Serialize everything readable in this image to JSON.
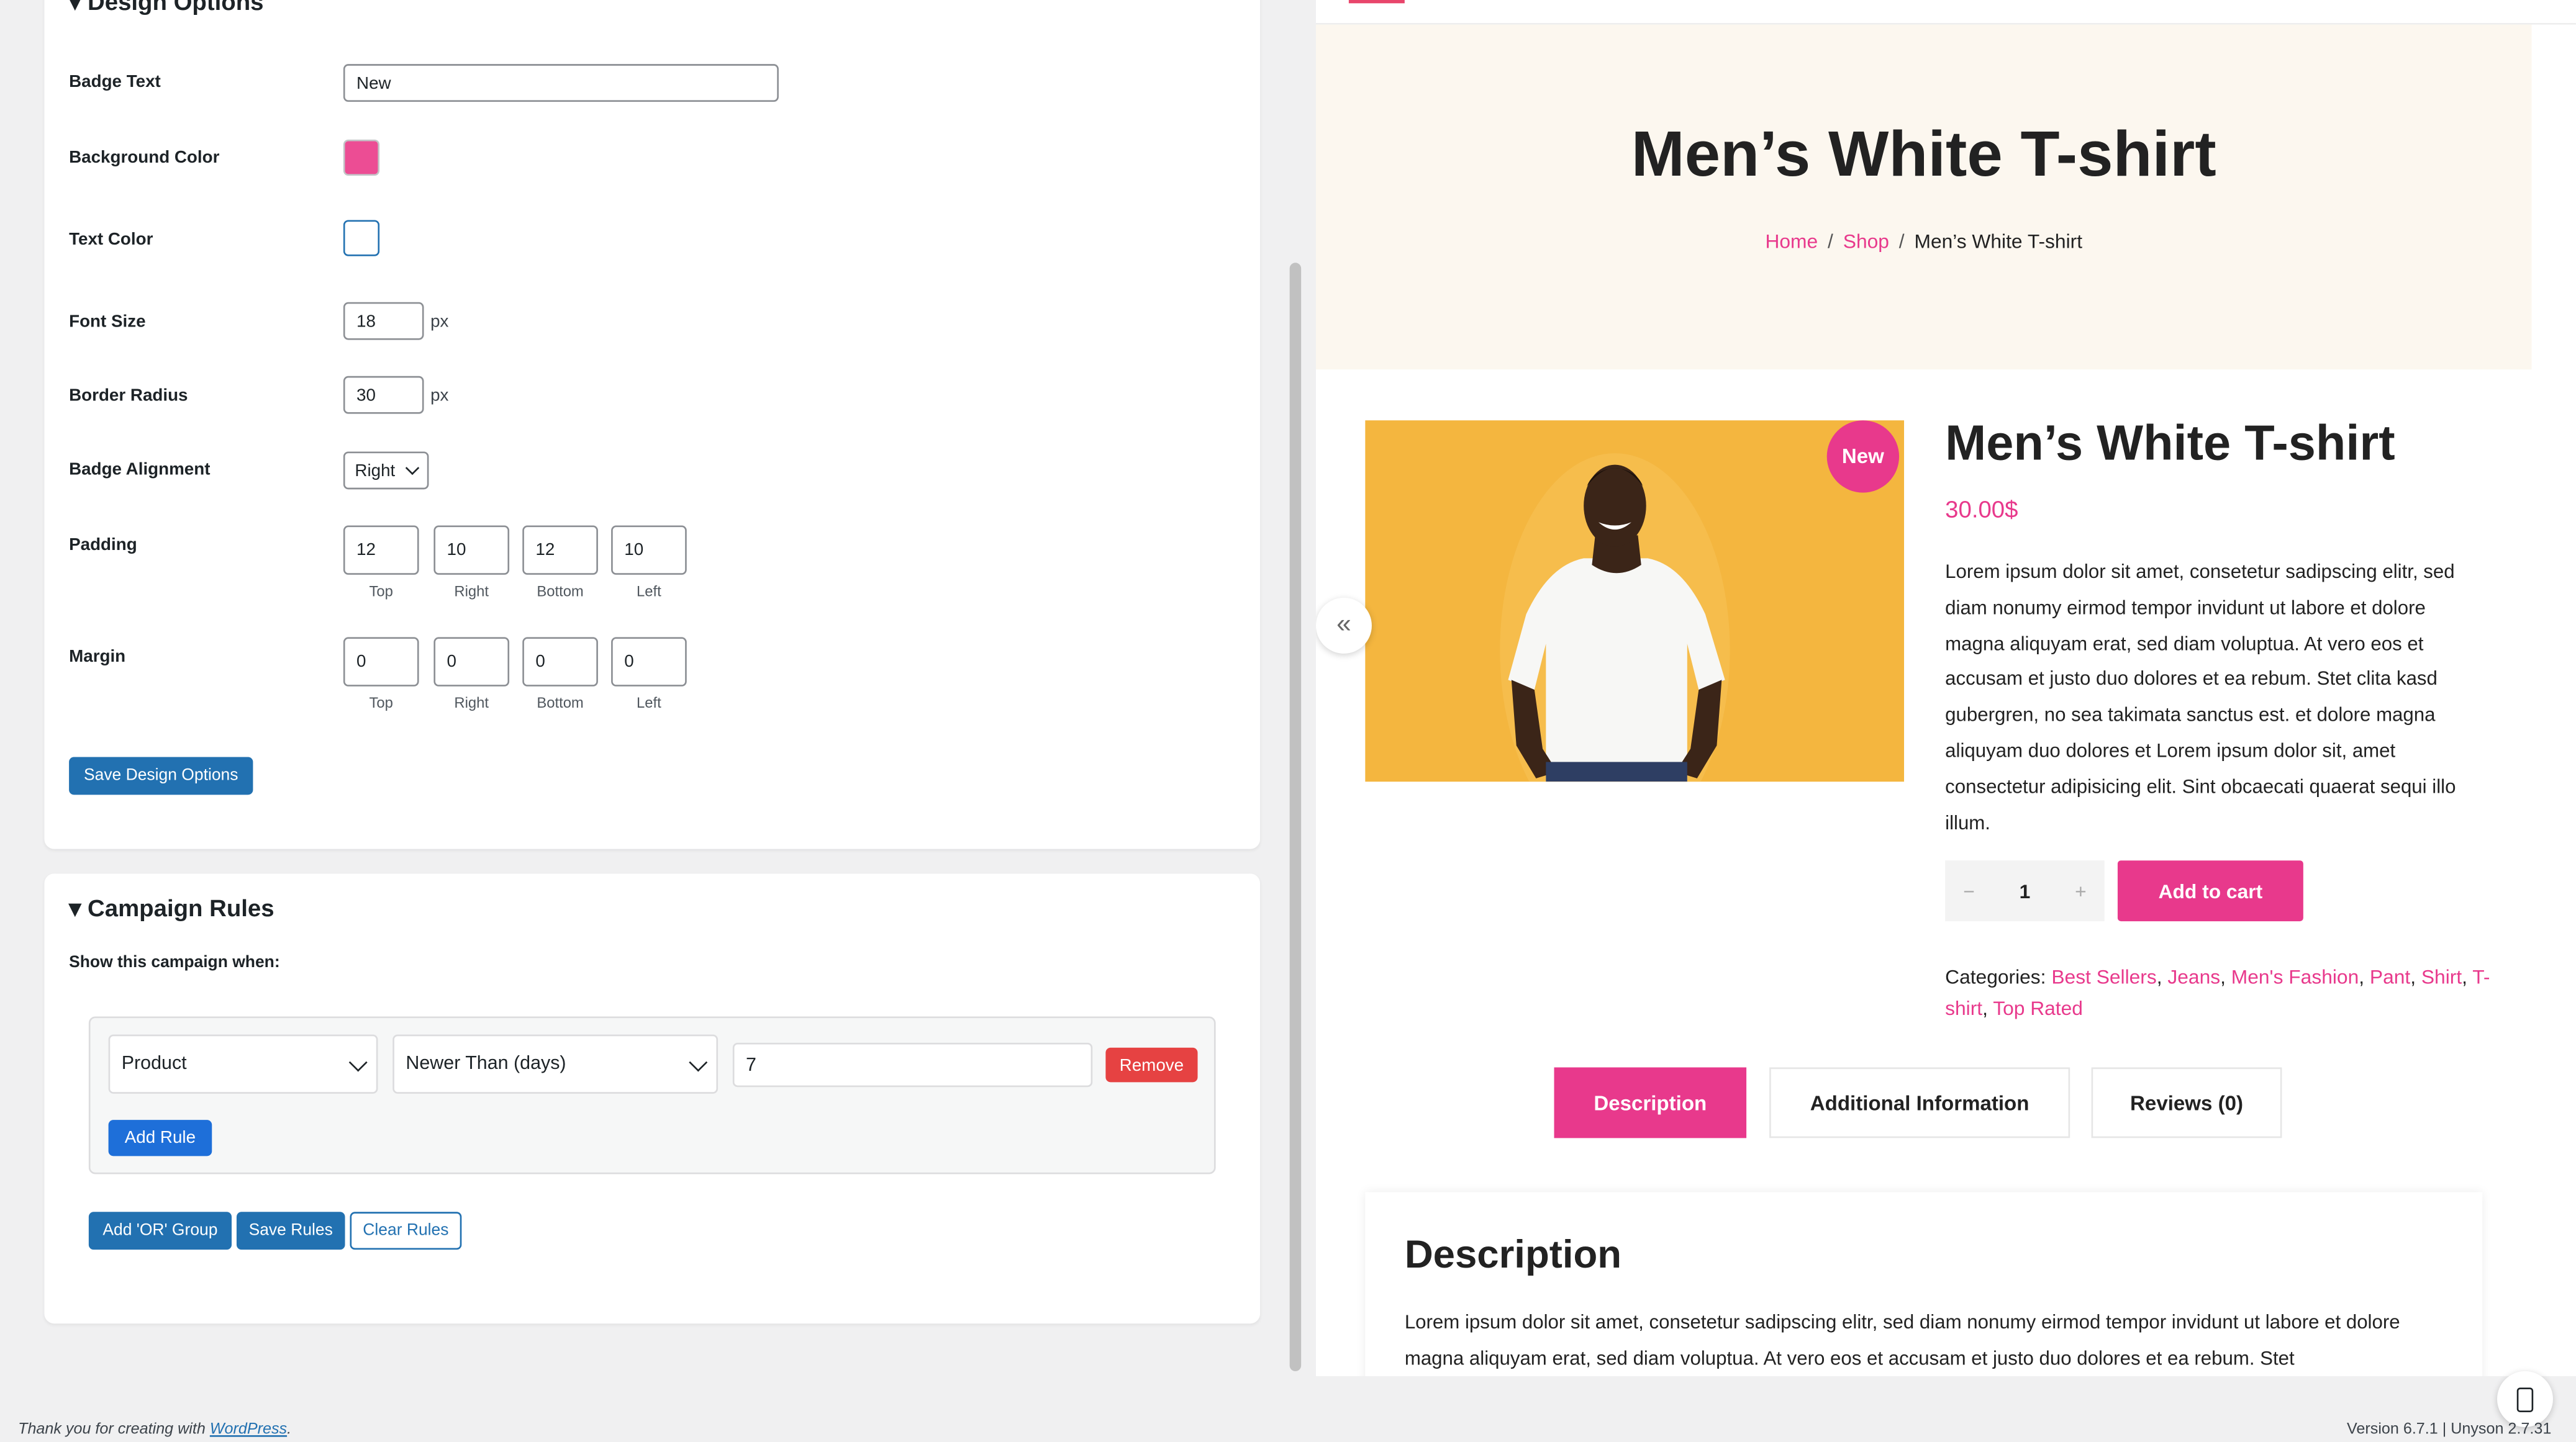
{
  "design": {
    "title": "Design Options",
    "badge_text_label": "Badge Text",
    "badge_text_value": "New",
    "bg_color_label": "Background Color",
    "bg_color": "#ec4d94",
    "text_color_label": "Text Color",
    "text_color": "#ffffff",
    "font_size_label": "Font Size",
    "font_size_value": "18",
    "border_radius_label": "Border Radius",
    "border_radius_value": "30",
    "unit_px": "px",
    "alignment_label": "Badge Alignment",
    "alignment_value": "Right",
    "padding_label": "Padding",
    "padding": [
      {
        "value": "12",
        "side": "Top"
      },
      {
        "value": "10",
        "side": "Right"
      },
      {
        "value": "12",
        "side": "Bottom"
      },
      {
        "value": "10",
        "side": "Left"
      }
    ],
    "margin_label": "Margin",
    "margin": [
      {
        "value": "0",
        "side": "Top"
      },
      {
        "value": "0",
        "side": "Right"
      },
      {
        "value": "0",
        "side": "Bottom"
      },
      {
        "value": "0",
        "side": "Left"
      }
    ],
    "save_label": "Save Design Options"
  },
  "rules": {
    "title": "Campaign Rules",
    "intro": "Show this campaign when:",
    "rule": {
      "subject": "Product",
      "condition": "Newer Than (days)",
      "value": "7",
      "remove_label": "Remove"
    },
    "add_rule_label": "Add Rule",
    "add_or_label": "Add 'OR' Group",
    "save_label": "Save Rules",
    "clear_label": "Clear Rules"
  },
  "preview": {
    "hero_title": "Men’s White T-shirt",
    "breadcrumb": {
      "home": "Home",
      "shop": "Shop",
      "current": "Men’s White T-shirt",
      "sep": "/"
    },
    "badge": "New",
    "gallery_arrow": "«",
    "product_title": "Men’s White T-shirt",
    "price": "30.00$",
    "description": "Lorem ipsum dolor sit amet, consetetur sadipscing elitr, sed diam nonumy eirmod tempor invidunt ut labore et dolore magna aliquyam erat, sed diam voluptua. At vero eos et accusam et justo duo dolores et ea rebum. Stet clita kasd gubergren, no sea takimata sanctus est. et dolore magna aliquyam duo dolores et Lorem ipsum dolor sit, amet consectetur adipisicing elit. Sint obcaecati quaerat sequi illo illum.",
    "qty": {
      "minus": "−",
      "value": "1",
      "plus": "+"
    },
    "add_to_cart": "Add to cart",
    "categories_label": "Categories:",
    "categories": [
      "Best Sellers",
      "Jeans",
      "Men's Fashion",
      "Pant",
      "Shirt",
      "T-shirt",
      "Top Rated"
    ],
    "tabs": [
      "Description",
      "Additional Information",
      "Reviews (0)"
    ],
    "desc_heading": "Description",
    "desc_body": "Lorem ipsum dolor sit amet, consetetur sadipscing elitr, sed diam nonumy eirmod tempor invidunt ut labore et dolore magna aliquyam erat, sed diam voluptua. At vero eos et accusam et justo duo dolores et ea rebum. Stet"
  },
  "footer": {
    "thanks_prefix": "Thank you for creating with ",
    "wp_link": "WordPress",
    "thanks_suffix": ".",
    "version": "Version 6.7.1 | Unyson 2.7.31"
  },
  "colors": {
    "admin_blue": "#2271b1",
    "remove_red": "#e64242",
    "brand_pink": "#e8398c"
  },
  "icons": {
    "collapse": "triangle-down-icon",
    "select": "chevron-down-icon",
    "mobile": "mobile-device-icon"
  }
}
